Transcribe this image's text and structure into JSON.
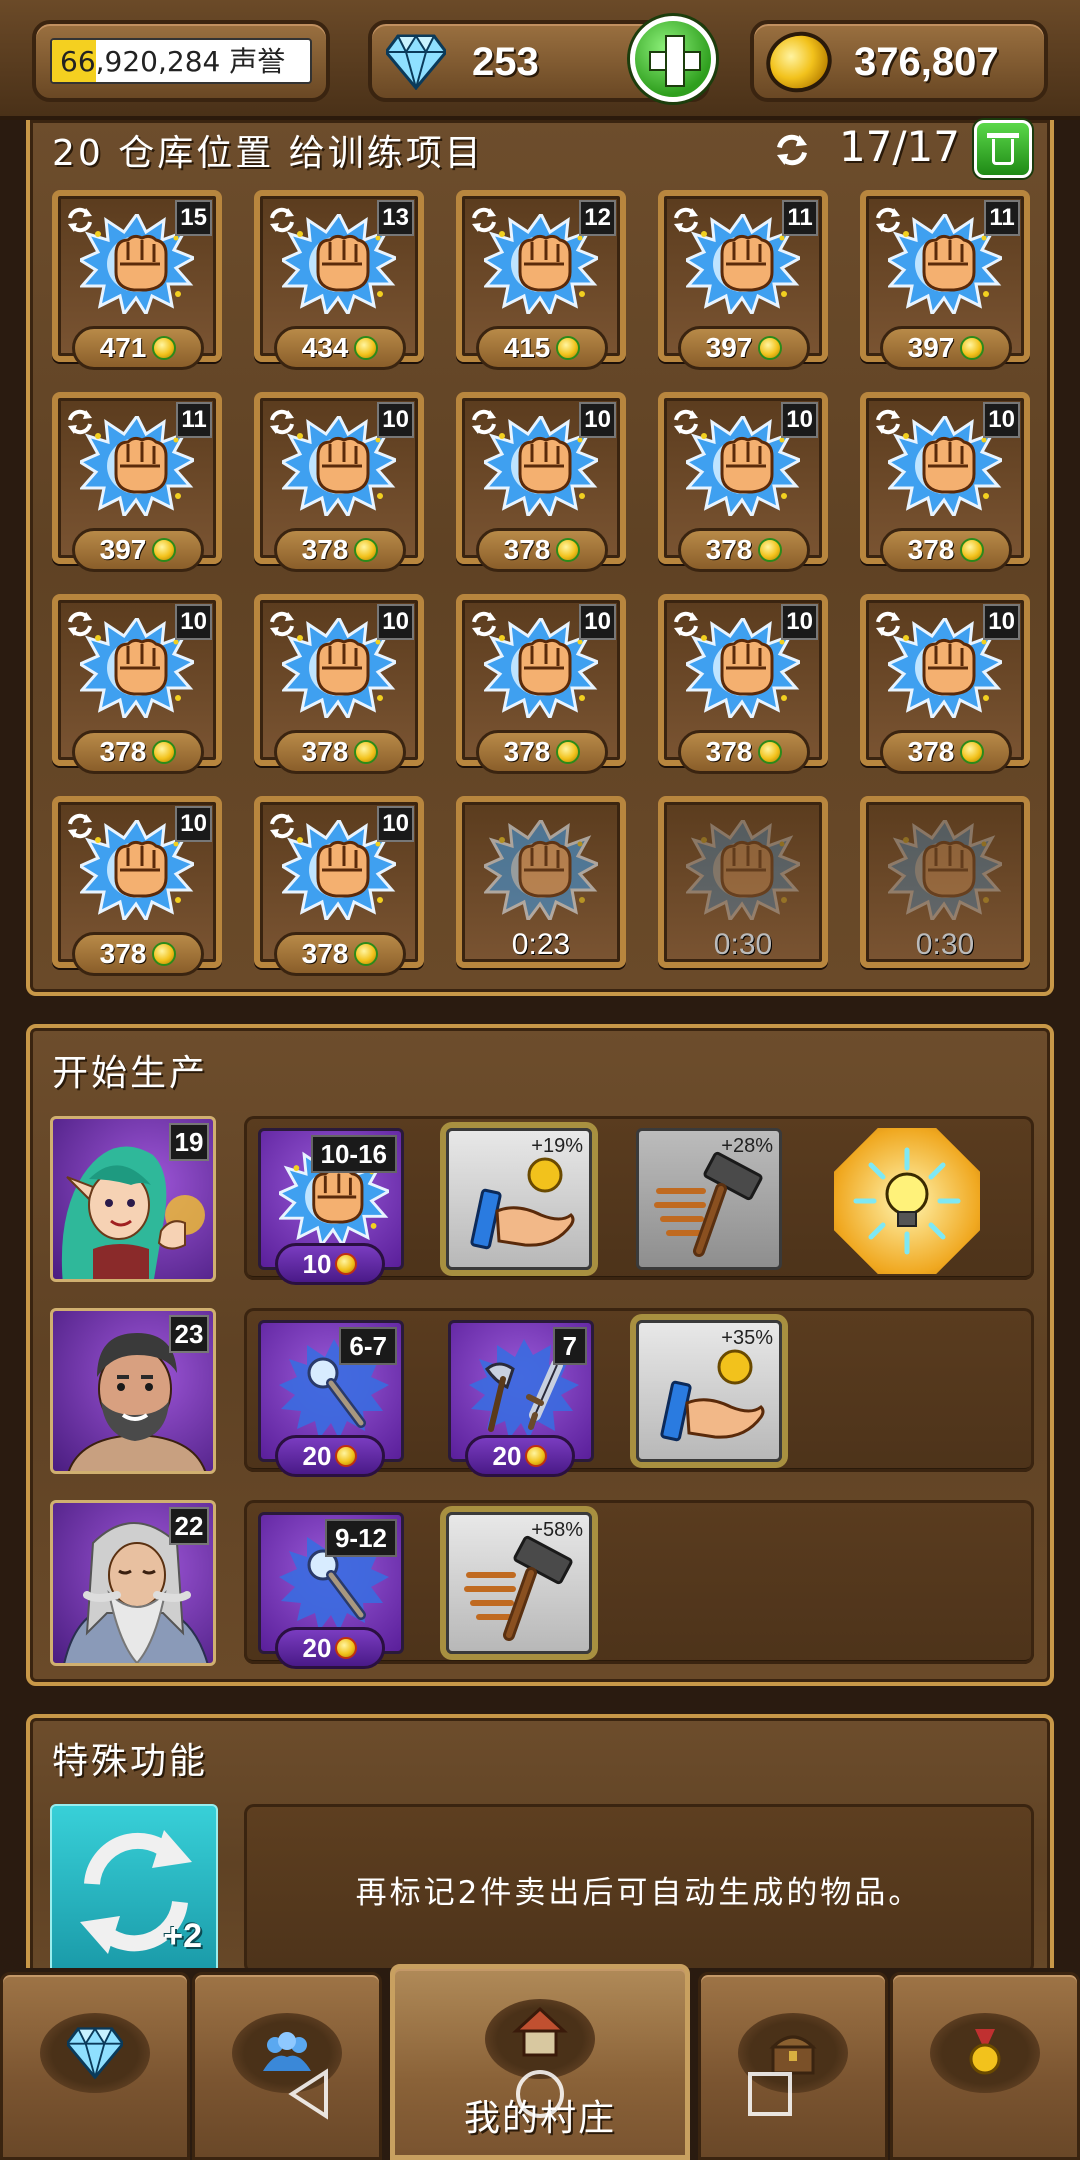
{
  "topbar": {
    "reputation_value": "66,920,284",
    "reputation_label": "声誉",
    "reputation_progress_percent": 17,
    "gems": "253",
    "gold": "376,807"
  },
  "storage": {
    "title": "20 仓库位置 给训练项目",
    "count": "17/17",
    "slots": [
      {
        "level": "15",
        "price": "471"
      },
      {
        "level": "13",
        "price": "434"
      },
      {
        "level": "12",
        "price": "415"
      },
      {
        "level": "11",
        "price": "397"
      },
      {
        "level": "11",
        "price": "397"
      },
      {
        "level": "11",
        "price": "397"
      },
      {
        "level": "10",
        "price": "378"
      },
      {
        "level": "10",
        "price": "378"
      },
      {
        "level": "10",
        "price": "378"
      },
      {
        "level": "10",
        "price": "378"
      },
      {
        "level": "10",
        "price": "378"
      },
      {
        "level": "10",
        "price": "378"
      },
      {
        "level": "10",
        "price": "378"
      },
      {
        "level": "10",
        "price": "378"
      },
      {
        "level": "10",
        "price": "378"
      },
      {
        "level": "10",
        "price": "378"
      },
      {
        "level": "10",
        "price": "378"
      }
    ],
    "timers": [
      "0:23",
      "0:30",
      "0:30"
    ]
  },
  "production": {
    "title": "开始生产",
    "heroes": [
      {
        "level": "19",
        "items": [
          {
            "range": "10-16",
            "cost": "10"
          }
        ],
        "boosts": [
          "+19%",
          "+28%"
        ]
      },
      {
        "level": "23",
        "items": [
          {
            "range": "6-7",
            "cost": "20"
          },
          {
            "range": "7",
            "cost": "20"
          }
        ],
        "boosts": [
          "+35%"
        ]
      },
      {
        "level": "22",
        "items": [
          {
            "range": "9-12",
            "cost": "20"
          }
        ],
        "boosts": [
          "+58%"
        ]
      }
    ]
  },
  "special": {
    "title": "特殊功能",
    "badge": "+2",
    "description": "再标记2件卖出后可自动生成的物品。"
  },
  "nav": {
    "active_label": "我的村庄"
  },
  "colors": {
    "wood_frame": "#b8863e",
    "accent_green": "#2f9f1e",
    "purple": "#5a1f9a",
    "teal": "#1a9aa8"
  }
}
